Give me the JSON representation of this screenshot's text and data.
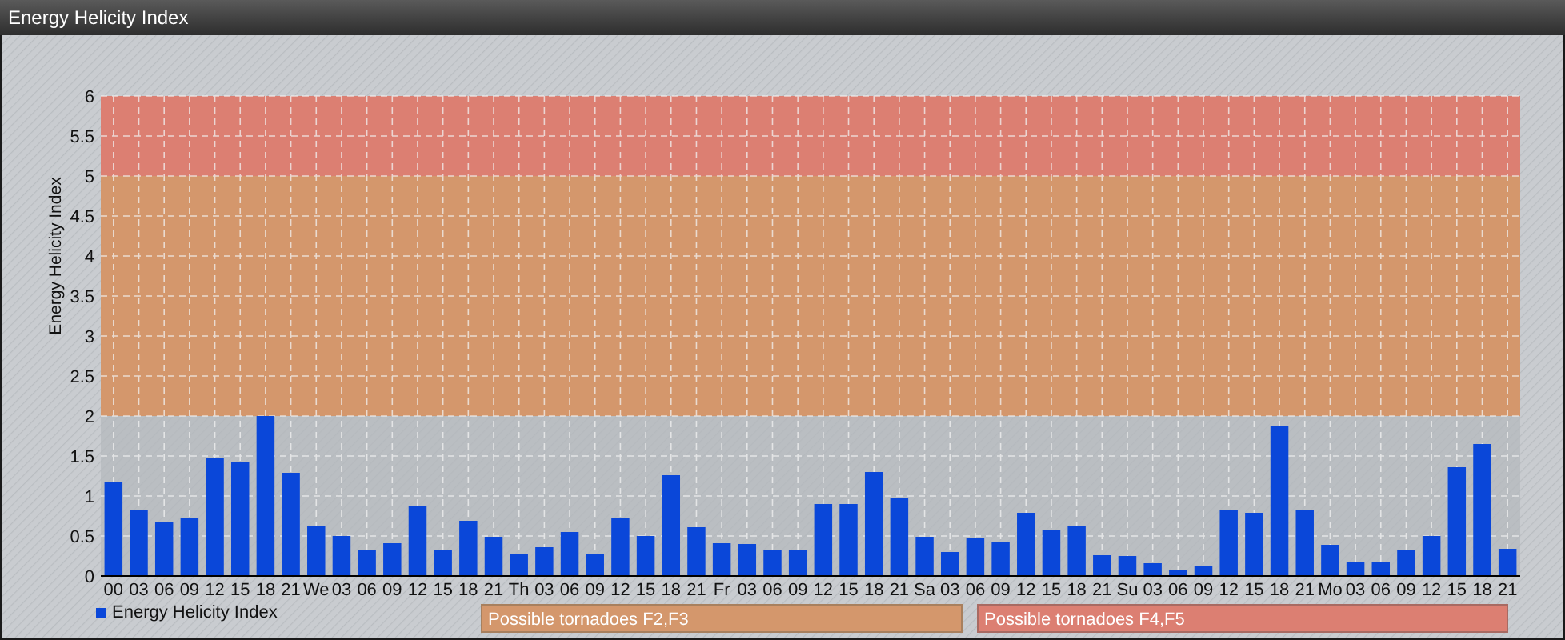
{
  "window": {
    "title": "Energy Helicity Index"
  },
  "chart_data": {
    "type": "bar",
    "ylabel": "Energy Helicity Index",
    "ylim": [
      0,
      6
    ],
    "yticks": [
      0,
      0.5,
      1,
      1.5,
      2,
      2.5,
      3,
      3.5,
      4,
      4.5,
      5,
      5.5,
      6
    ],
    "categories": [
      "00",
      "03",
      "06",
      "09",
      "12",
      "15",
      "18",
      "21",
      "We",
      "03",
      "06",
      "09",
      "12",
      "15",
      "18",
      "21",
      "Th",
      "03",
      "06",
      "09",
      "12",
      "15",
      "18",
      "21",
      "Fr",
      "03",
      "06",
      "09",
      "12",
      "15",
      "18",
      "21",
      "Sa",
      "03",
      "06",
      "09",
      "12",
      "15",
      "18",
      "21",
      "Su",
      "03",
      "06",
      "09",
      "12",
      "15",
      "18",
      "21",
      "Mo",
      "03",
      "06",
      "09",
      "12",
      "15",
      "18",
      "21"
    ],
    "series": [
      {
        "name": "Energy Helicity Index",
        "color": "#0a47d9",
        "values": [
          1.17,
          0.83,
          0.67,
          0.72,
          1.48,
          1.43,
          2.0,
          1.29,
          0.62,
          0.5,
          0.33,
          0.41,
          0.88,
          0.33,
          0.69,
          0.49,
          0.27,
          0.36,
          0.55,
          0.28,
          0.73,
          0.5,
          1.26,
          0.61,
          0.41,
          0.4,
          0.33,
          0.33,
          0.9,
          0.9,
          1.3,
          0.97,
          0.49,
          0.3,
          0.47,
          0.43,
          0.79,
          0.58,
          0.63,
          0.26,
          0.25,
          0.16,
          0.08,
          0.13,
          0.83,
          0.79,
          1.87,
          0.83,
          0.39,
          0.17,
          0.18,
          0.32,
          0.5,
          1.36,
          1.65,
          0.34
        ]
      }
    ],
    "grid": true,
    "bands": [
      {
        "axis": "y",
        "from": 2,
        "to": 5,
        "color": "#d4976c"
      },
      {
        "axis": "y",
        "from": 5,
        "to": 6,
        "color": "#dc7f72"
      }
    ]
  },
  "zone_legend": [
    {
      "label": "Possible tornadoes F2,F3",
      "color": "#d4976c"
    },
    {
      "label": "Possible tornadoes F4,F5",
      "color": "#dc7f72"
    }
  ]
}
